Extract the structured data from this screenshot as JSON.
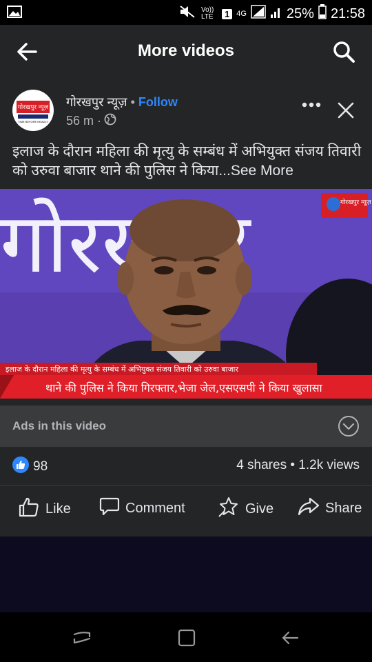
{
  "status": {
    "battery": "25%",
    "time": "21:58",
    "network": "4G",
    "volte": "Vo)) LTE",
    "sim": "1"
  },
  "appbar": {
    "title": "More videos"
  },
  "post": {
    "page_name": "गोरखपुर न्यूज़",
    "separator": "•",
    "follow_label": "Follow",
    "time": "56 m ·",
    "caption": "इलाज के दौरान महिला की मृत्यु के सम्बंध में अभियुक्त संजय तिवारी को उरुवा बाजार थाने की पुलिस ने किया...",
    "see_more": "See More",
    "avatar_text": "गोरखपुर न्यूज़",
    "avatar_sub": "TIME BEFORE HEADLY"
  },
  "video": {
    "banner_line1": "इलाज के दौरान महिला की मृत्यु के सम्बंध में अभियुक्त संजय तिवारी को उरुवा बाजार",
    "banner_line2": "थाने की पुलिस ने किया गिरफ्तार,भेजा जेल,एसएसपी ने किया खुलासा",
    "backdrop_text": "गोरखपुर",
    "logo_text": "गोरखपुर न्यूज़"
  },
  "ads": {
    "label": "Ads in this video"
  },
  "stats": {
    "likes": "98",
    "shares": "4 shares",
    "dot": "•",
    "views": "1.2k views"
  },
  "actions": {
    "like": "Like",
    "comment": "Comment",
    "give": "Give",
    "share": "Share"
  },
  "colors": {
    "accent": "#2d88ff",
    "banner_red": "#d81f26",
    "backdrop_purple": "#5a3fb0"
  }
}
